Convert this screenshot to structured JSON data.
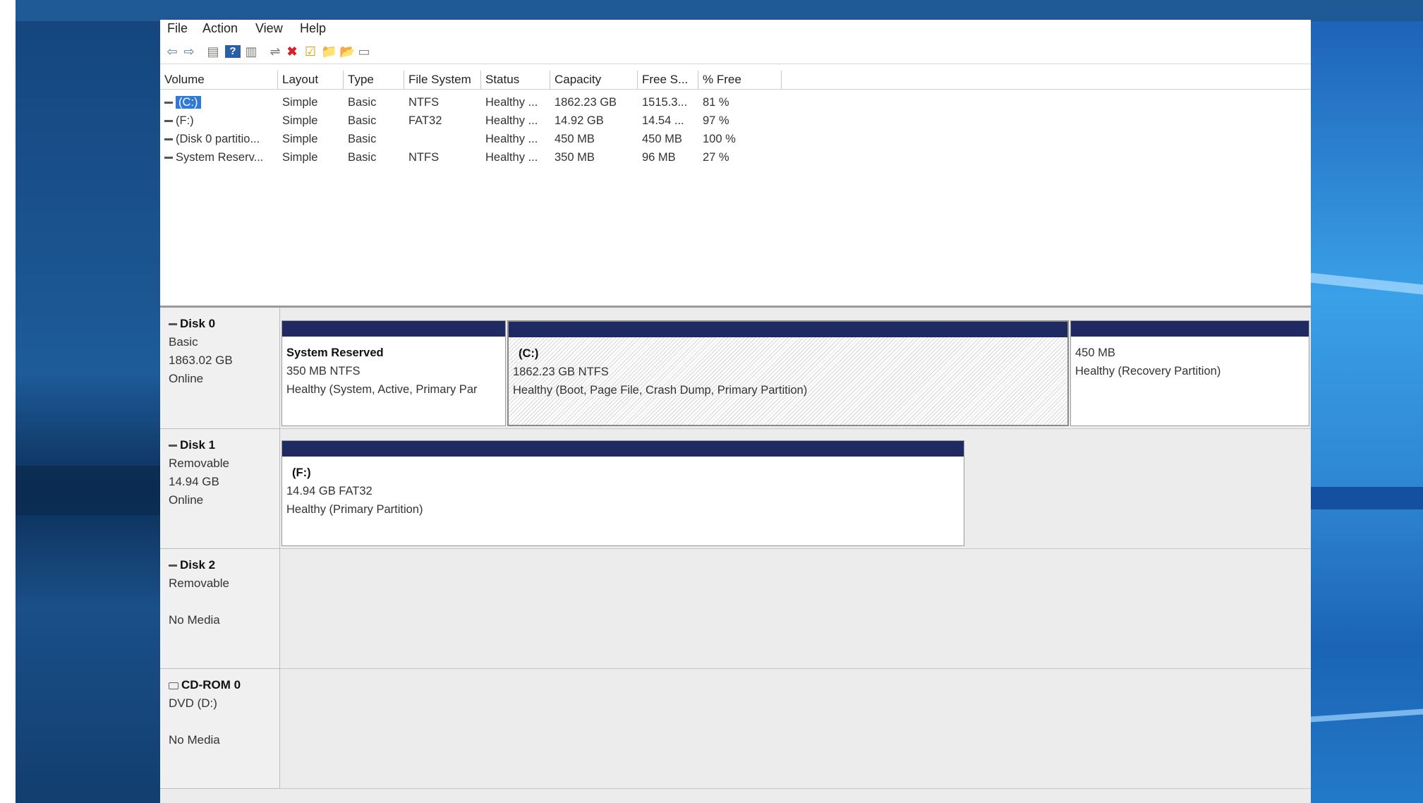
{
  "menu": [
    "File",
    "Action",
    "View",
    "Help"
  ],
  "toolbar": {
    "back": "⇦",
    "forward": "⇨",
    "grid": "▤",
    "help": "?",
    "list": "▥",
    "connect": "⇌",
    "delete": "✖",
    "check": "☑",
    "folder": "📁",
    "explore": "📂",
    "view": "▭"
  },
  "volume_table": {
    "columns": [
      "Volume",
      "Layout",
      "Type",
      "File System",
      "Status",
      "Capacity",
      "Free S...",
      "% Free"
    ],
    "rows": [
      [
        "(C:)",
        "Simple",
        "Basic",
        "NTFS",
        "Healthy ...",
        "1862.23 GB",
        "1515.3...",
        "81 %"
      ],
      [
        "(F:)",
        "Simple",
        "Basic",
        "FAT32",
        "Healthy ...",
        "14.92 GB",
        "14.54 ...",
        "97 %"
      ],
      [
        "(Disk 0 partitio...",
        "Simple",
        "Basic",
        "",
        "Healthy ...",
        "450 MB",
        "450 MB",
        "100 %"
      ],
      [
        "System Reserv...",
        "Simple",
        "Basic",
        "NTFS",
        "Healthy ...",
        "350 MB",
        "96 MB",
        "27 %"
      ]
    ]
  },
  "disks": [
    {
      "name": "Disk 0",
      "type": "Basic",
      "size": "1863.02 GB",
      "state": "Online",
      "partitions": [
        {
          "title": "System Reserved",
          "detail": "350 MB NTFS",
          "status": "Healthy (System, Active, Primary Par"
        },
        {
          "title": "(C:)",
          "detail": "1862.23 GB NTFS",
          "status": "Healthy (Boot, Page File, Crash Dump, Primary Partition)"
        },
        {
          "title": "",
          "detail": "450 MB",
          "status": "Healthy (Recovery Partition)"
        }
      ]
    },
    {
      "name": "Disk 1",
      "type": "Removable",
      "size": "14.94 GB",
      "state": "Online",
      "partitions": [
        {
          "title": "(F:)",
          "detail": "14.94 GB FAT32",
          "status": "Healthy (Primary Partition)"
        }
      ]
    },
    {
      "name": "Disk 2",
      "type": "Removable",
      "size": "",
      "state": "No Media"
    },
    {
      "name": "CD-ROM 0",
      "type": "DVD (D:)",
      "size": "",
      "state": "No Media"
    }
  ],
  "colors": {
    "partition_bar": "#1f2a63",
    "selection": "#2f7ad9"
  }
}
